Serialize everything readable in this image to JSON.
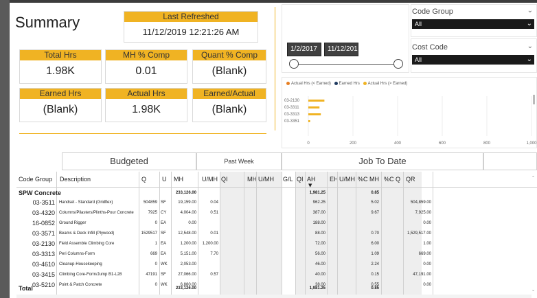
{
  "summary": {
    "title": "Summary",
    "last_refreshed": {
      "label": "Last Refreshed",
      "value": "11/12/2019 12:21:26 AM"
    },
    "kpis": [
      {
        "label": "Total Hrs",
        "value": "1.98K"
      },
      {
        "label": "MH % Comp",
        "value": "0.01"
      },
      {
        "label": "Quant % Comp",
        "value": "(Blank)"
      },
      {
        "label": "Earned Hrs",
        "value": "(Blank)"
      },
      {
        "label": "Actual Hrs",
        "value": "1.98K"
      },
      {
        "label": "Earned/Actual",
        "value": "(Blank)"
      }
    ]
  },
  "date_slicer": {
    "start": "1/2/2017",
    "end": "11/12/201"
  },
  "slicers": [
    {
      "label": "Code Group",
      "value": "All"
    },
    {
      "label": "Cost Code",
      "value": "All"
    }
  ],
  "colors": {
    "accent": "#f0b323",
    "actual_lt": "#e67e22",
    "earned": "#1f3a5f",
    "actual_gt": "#f0b323"
  },
  "chart_data": {
    "type": "bar",
    "orientation": "horizontal",
    "legend": [
      "Actual Hrs (< Earned)",
      "Earned Hrs",
      "Actual Hrs (> Earned)"
    ],
    "categories": [
      "03-2130",
      "03-3311",
      "03-3313",
      "03-3351"
    ],
    "series": [
      {
        "name": "Actual Hrs (> Earned)",
        "values": [
          72,
          50,
          56,
          8
        ]
      }
    ],
    "xticks": [
      "0",
      "200",
      "400",
      "600",
      "800",
      "1,000"
    ],
    "xlim": [
      0,
      1000
    ]
  },
  "sections": {
    "budgeted": "Budgeted",
    "past_week": "Past Week",
    "job_to_date": "Job To Date"
  },
  "table": {
    "columns": [
      "Code Group",
      "Description",
      "Q",
      "U",
      "MH",
      "U/MH",
      "QI",
      "MH",
      "U/MH",
      "G/L",
      "QI",
      "AH",
      "EH",
      "U/MH",
      "%C MH",
      "%C Q",
      "QR"
    ],
    "group": {
      "code": "SPW Concrete",
      "mh": "233,126.00",
      "ah": "1,981.25",
      "cmh": "0.85"
    },
    "rows": [
      {
        "code": "03-3511",
        "desc": "Handset - Standard (Gridflex)",
        "q": "504859",
        "u": "SF",
        "mh": "19,159.00",
        "umh": "0.04",
        "ah": "962.25",
        "cmh": "5.02",
        "qr": "504,859.00"
      },
      {
        "code": "03-4320",
        "desc": "Columns/Pilasters/Plinths-Pour Concrete",
        "q": "7925",
        "u": "CY",
        "mh": "4,004.00",
        "umh": "0.51",
        "ah": "387.00",
        "cmh": "9.67",
        "qr": "7,925.00"
      },
      {
        "code": "16-0852",
        "desc": "Ground Rigger",
        "q": "0",
        "u": "EA",
        "mh": "0.00",
        "umh": "",
        "ah": "188.00",
        "cmh": "",
        "qr": "0.00"
      },
      {
        "code": "03-3571",
        "desc": "Beams & Deck Infill (Plywood)",
        "q": "1529517",
        "u": "SF",
        "mh": "12,548.00",
        "umh": "0.01",
        "ah": "88.00",
        "cmh": "0.70",
        "qr": "1,529,517.00"
      },
      {
        "code": "03-2130",
        "desc": "Field Assemble Climbing Core",
        "q": "1",
        "u": "EA",
        "mh": "1,200.00",
        "umh": "1,200.00",
        "ah": "72.00",
        "cmh": "6.00",
        "qr": "1.00"
      },
      {
        "code": "03-3313",
        "desc": "Peri Columns-Form",
        "q": "669",
        "u": "EA",
        "mh": "5,151.00",
        "umh": "7.70",
        "ah": "56.00",
        "cmh": "1.09",
        "qr": "669.00"
      },
      {
        "code": "03-4610",
        "desc": "Cleanup-Housekeeping",
        "q": "0",
        "u": "WK",
        "mh": "2,053.00",
        "umh": "",
        "ah": "46.00",
        "cmh": "2.24",
        "qr": "0.00"
      },
      {
        "code": "03-3415",
        "desc": "Climbing Core-Form/Jump B1-L28",
        "q": "47191",
        "u": "SF",
        "mh": "27,066.00",
        "umh": "0.57",
        "ah": "40.00",
        "cmh": "0.15",
        "qr": "47,191.00"
      },
      {
        "code": "03-5210",
        "desc": "Point & Patch Concrete",
        "q": "0",
        "u": "WK",
        "mh": "6,880.00",
        "umh": "",
        "ah": "38.00",
        "cmh": "0.55",
        "qr": "0.00"
      }
    ],
    "total": {
      "label": "Total",
      "mh": "233,126.00",
      "ah": "1,981.25",
      "cmh": "0.85"
    }
  }
}
